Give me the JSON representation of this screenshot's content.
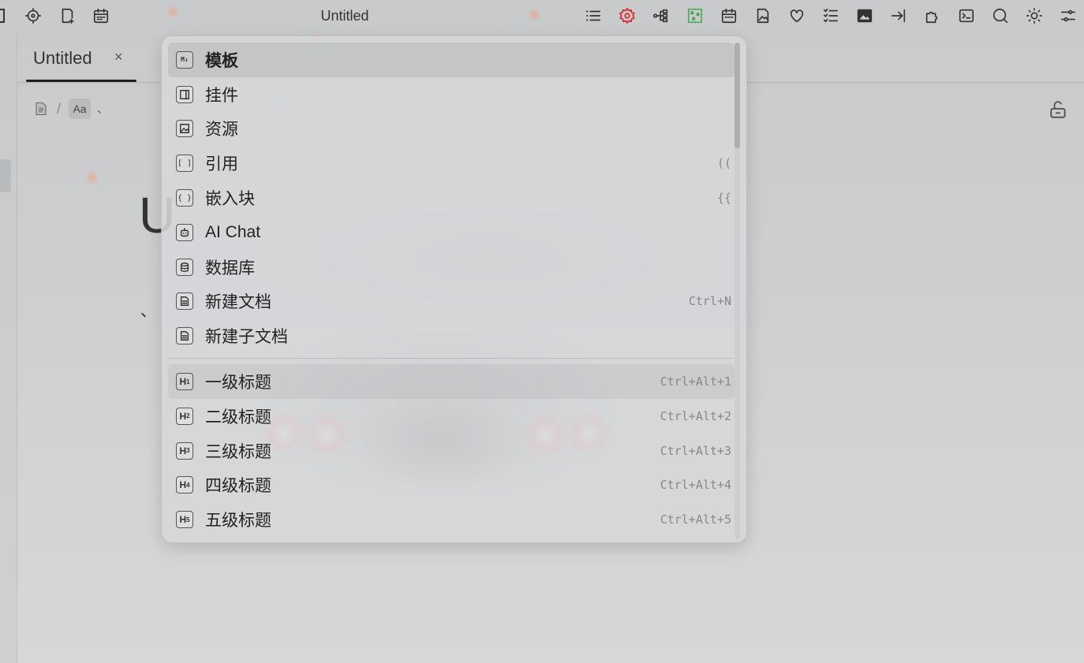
{
  "window": {
    "title": "Untitled"
  },
  "toolbar": {
    "left_icons": [
      "sidebar-edge-icon",
      "locate-icon",
      "new-doc-icon",
      "calendar-icon"
    ],
    "right_icons": [
      "outline-icon",
      "settings-gear-icon",
      "tree-icon",
      "graph-icon",
      "calendar-icon",
      "image-file-icon",
      "heart-icon",
      "list-icon",
      "image-icon",
      "login-icon",
      "puzzle-icon",
      "terminal-icon",
      "search-icon",
      "sun-icon",
      "sliders-icon"
    ],
    "accent_colors": {
      "settings_gear": "#d9232a",
      "graph": "#3aa64a"
    }
  },
  "tab": {
    "label": "Untitled",
    "close": "×"
  },
  "breadcrumb": {
    "sep": "/",
    "block_type": "Aa",
    "trail": "、"
  },
  "document": {
    "title_partial": "U",
    "body_mark": "、"
  },
  "menu": {
    "items": [
      {
        "label": "模板",
        "icon": "M↓",
        "hint": "",
        "active": true
      },
      {
        "label": "挂件",
        "icon": "widget",
        "hint": ""
      },
      {
        "label": "资源",
        "icon": "image",
        "hint": ""
      },
      {
        "label": "引用",
        "icon": "[ ]",
        "hint": "(("
      },
      {
        "label": "嵌入块",
        "icon": "{ }",
        "hint": "{{"
      },
      {
        "label": "AI Chat",
        "icon": "robot",
        "hint": ""
      },
      {
        "label": "数据库",
        "icon": "database",
        "hint": ""
      },
      {
        "label": "新建文档",
        "icon": "doc",
        "hint": "Ctrl+N"
      },
      {
        "label": "新建子文档",
        "icon": "doc",
        "hint": ""
      }
    ],
    "headings": [
      {
        "label": "一级标题",
        "icon_h": "H",
        "icon_n": "1",
        "hint": "Ctrl+Alt+1"
      },
      {
        "label": "二级标题",
        "icon_h": "H",
        "icon_n": "2",
        "hint": "Ctrl+Alt+2"
      },
      {
        "label": "三级标题",
        "icon_h": "H",
        "icon_n": "3",
        "hint": "Ctrl+Alt+3"
      },
      {
        "label": "四级标题",
        "icon_h": "H",
        "icon_n": "4",
        "hint": "Ctrl+Alt+4"
      },
      {
        "label": "五级标题",
        "icon_h": "H",
        "icon_n": "5",
        "hint": "Ctrl+Alt+5"
      }
    ]
  }
}
